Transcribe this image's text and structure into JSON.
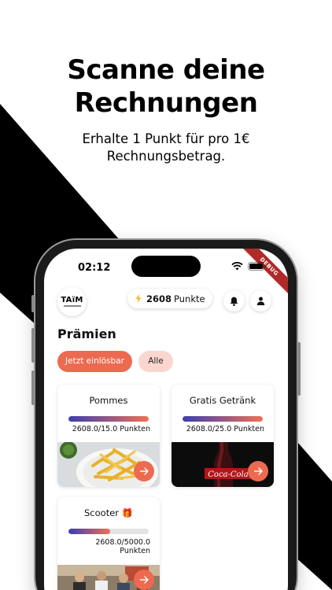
{
  "promo": {
    "headline_line1": "Scanne deine",
    "headline_line2": "Rechnungen",
    "subline_line1": "Erhalte 1 Punkt für pro 1€",
    "subline_line2": "Rechnungsbetrag."
  },
  "status_bar": {
    "time": "02:12",
    "debug_banner": "DEBUG"
  },
  "header": {
    "logo_text": "TAïM",
    "points_value": "2608",
    "points_label": "Punkte",
    "icons": [
      "bolt-icon",
      "bell-icon",
      "profile-icon"
    ]
  },
  "rewards": {
    "title": "Prämien",
    "filters": {
      "redeemable": "Jetzt einlösbar",
      "all": "Alle"
    },
    "items": [
      {
        "name": "Pommes",
        "progress_text": "2608.0/15.0 Punkten",
        "progress_fraction": 1.0,
        "image": "fries-photo"
      },
      {
        "name": "Gratis Getränk",
        "progress_text": "2608.0/25.0 Punkten",
        "progress_fraction": 1.0,
        "image": "cola-bottle-photo"
      },
      {
        "name": "Scooter",
        "name_emoji": "🎁",
        "progress_text_line1": "2608.0/5000.0",
        "progress_text_line2": "Punkten",
        "progress_fraction": 0.52,
        "image": "group-photo"
      }
    ]
  },
  "colors": {
    "accent": "#ec6a4f",
    "accent_light": "#fad6cf",
    "progress_start": "#3a3fb0",
    "progress_end": "#ef7055",
    "stripe": "#000000"
  }
}
